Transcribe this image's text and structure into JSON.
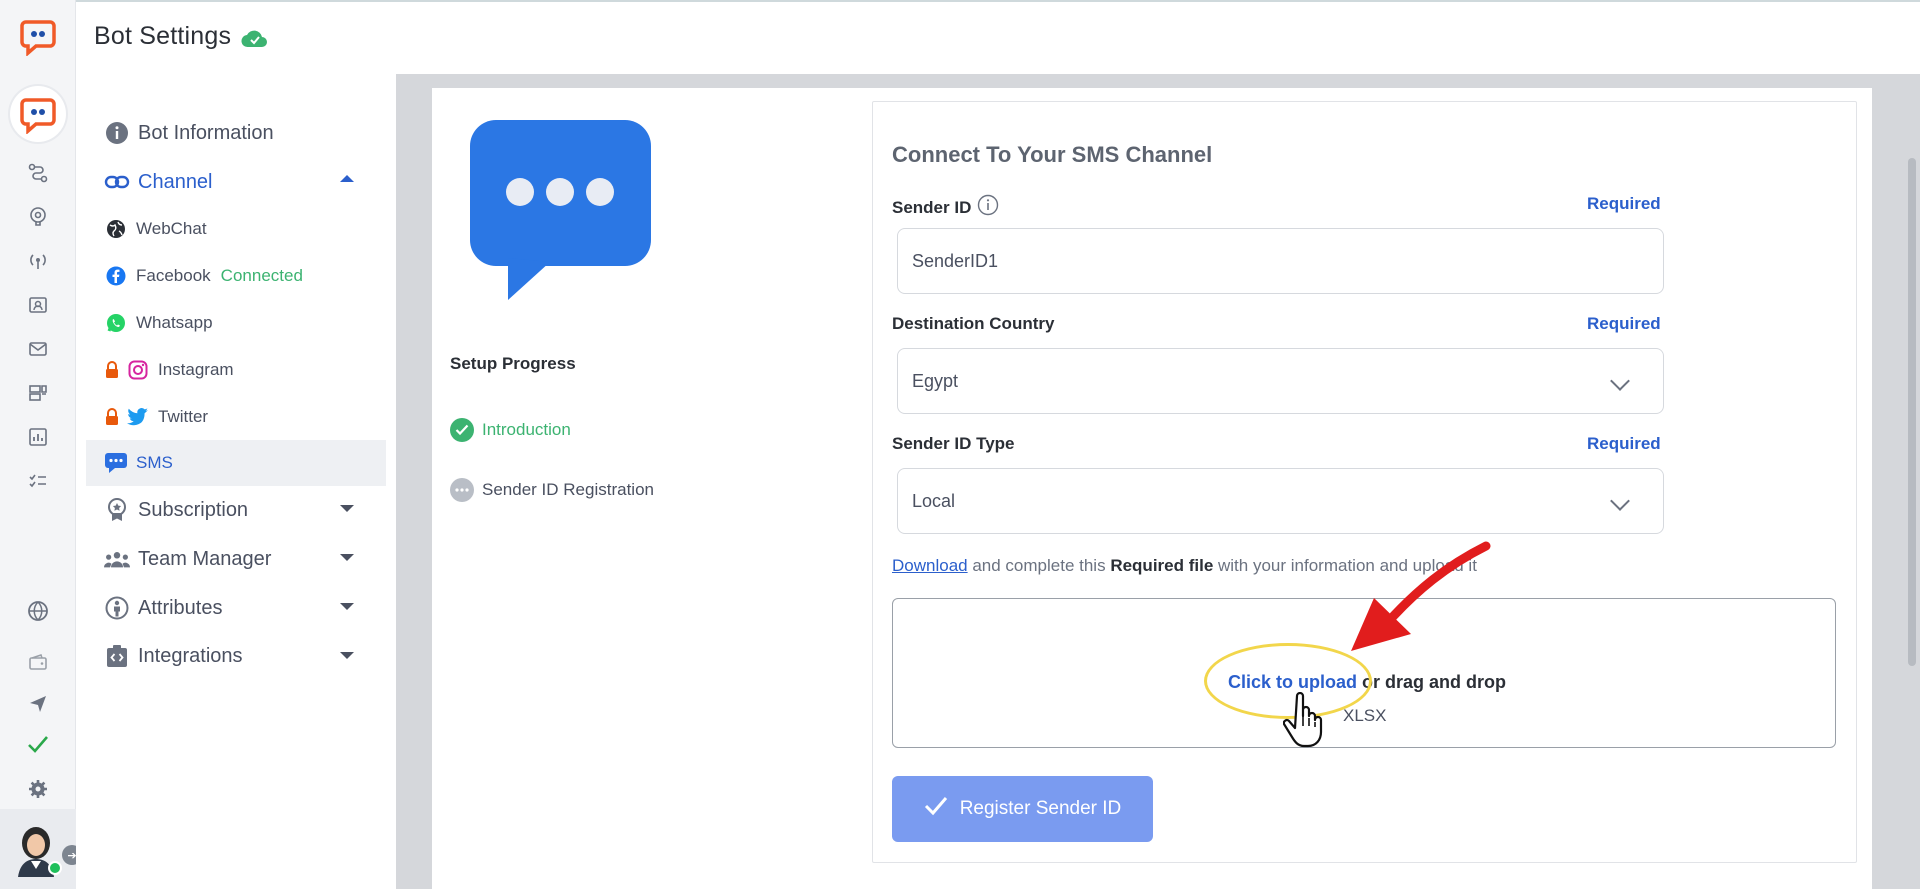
{
  "header": {
    "title": "Bot Settings"
  },
  "sidebar": {
    "items": [
      {
        "label": "Bot Information"
      },
      {
        "label": "Channel"
      },
      {
        "label": "Subscription"
      },
      {
        "label": "Team Manager"
      },
      {
        "label": "Attributes"
      },
      {
        "label": "Integrations"
      }
    ],
    "channels": [
      {
        "label": "WebChat"
      },
      {
        "label": "Facebook",
        "status": "Connected"
      },
      {
        "label": "Whatsapp"
      },
      {
        "label": "Instagram"
      },
      {
        "label": "Twitter"
      },
      {
        "label": "SMS"
      }
    ]
  },
  "progress": {
    "title": "Setup Progress",
    "steps": [
      {
        "label": "Introduction",
        "state": "done"
      },
      {
        "label": "Sender ID Registration",
        "state": "pending"
      }
    ]
  },
  "form": {
    "title": "Connect To Your SMS Channel",
    "required_label": "Required",
    "sender_id": {
      "label": "Sender ID",
      "value": "SenderID1"
    },
    "destination_country": {
      "label": "Destination Country",
      "value": "Egypt"
    },
    "sender_id_type": {
      "label": "Sender ID Type",
      "value": "Local"
    },
    "download": {
      "link": "Download",
      "text_before_bold": " and complete this ",
      "bold": "Required file",
      "text_after_bold": " with your information and upload it"
    },
    "upload": {
      "link": "Click to upload",
      "rest": " or drag and drop",
      "format": "XLSX"
    },
    "submit_label": "Register Sender ID"
  },
  "colors": {
    "accent": "#2b5fcc",
    "success": "#3cb371",
    "button": "#7a9bf0",
    "brand": "#f05a28"
  }
}
